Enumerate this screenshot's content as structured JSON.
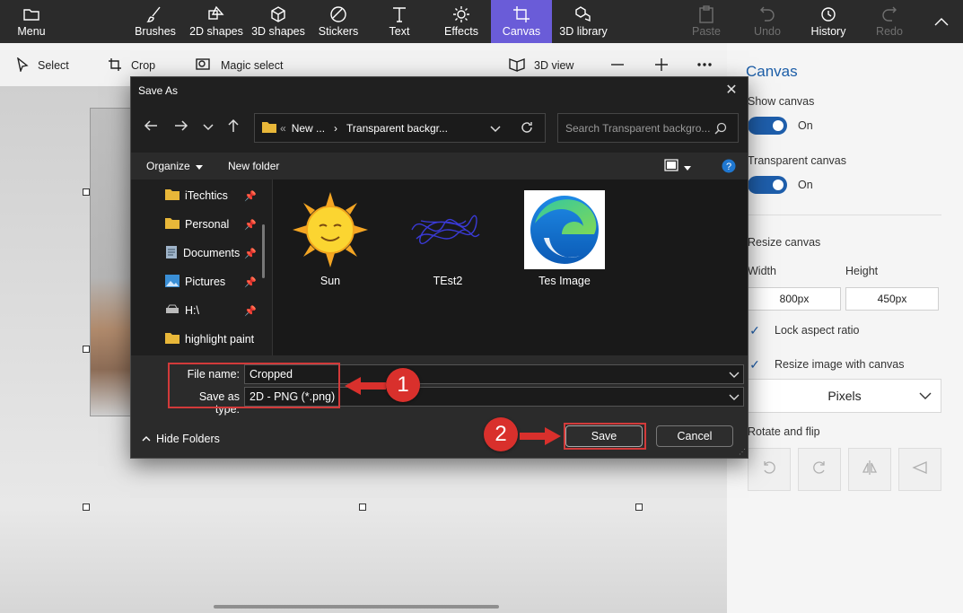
{
  "topbar": {
    "menu": "Menu",
    "tools": [
      "Brushes",
      "2D shapes",
      "3D shapes",
      "Stickers",
      "Text",
      "Effects",
      "Canvas",
      "3D library"
    ],
    "paste": "Paste",
    "undo": "Undo",
    "history": "History",
    "redo": "Redo"
  },
  "subbar": {
    "select": "Select",
    "crop": "Crop",
    "magic_select": "Magic select",
    "view3d": "3D view"
  },
  "panel": {
    "title": "Canvas",
    "show_canvas": "Show canvas",
    "show_canvas_state": "On",
    "transparent_canvas": "Transparent canvas",
    "transparent_canvas_state": "On",
    "resize_canvas": "Resize canvas",
    "width_label": "Width",
    "height_label": "Height",
    "width_value": "800px",
    "height_value": "450px",
    "lock_aspect": "Lock aspect ratio",
    "resize_image": "Resize image with canvas",
    "units": "Pixels",
    "rotate_flip": "Rotate and flip"
  },
  "dialog": {
    "title": "Save As",
    "address": {
      "prefix": "«",
      "part1": "New ...",
      "sep": "›",
      "part2": "Transparent backgr..."
    },
    "search_placeholder": "Search Transparent backgro...",
    "organize": "Organize",
    "new_folder": "New folder",
    "sidebar": [
      "iTechtics",
      "Personal",
      "Documents",
      "Pictures",
      "H:\\",
      "highlight paint"
    ],
    "files": [
      "Sun",
      "TEst2",
      "Tes Image"
    ],
    "file_name_label": "File name:",
    "file_name_value": "Cropped",
    "save_type_label": "Save as type:",
    "save_type_value": "2D - PNG (*.png)",
    "hide_folders": "Hide Folders",
    "save": "Save",
    "cancel": "Cancel"
  },
  "annotations": {
    "step1": "1",
    "step2": "2",
    "color": "#d9302c"
  },
  "colors": {
    "accent": "#6a5cd8",
    "toggle": "#1e5eab"
  }
}
